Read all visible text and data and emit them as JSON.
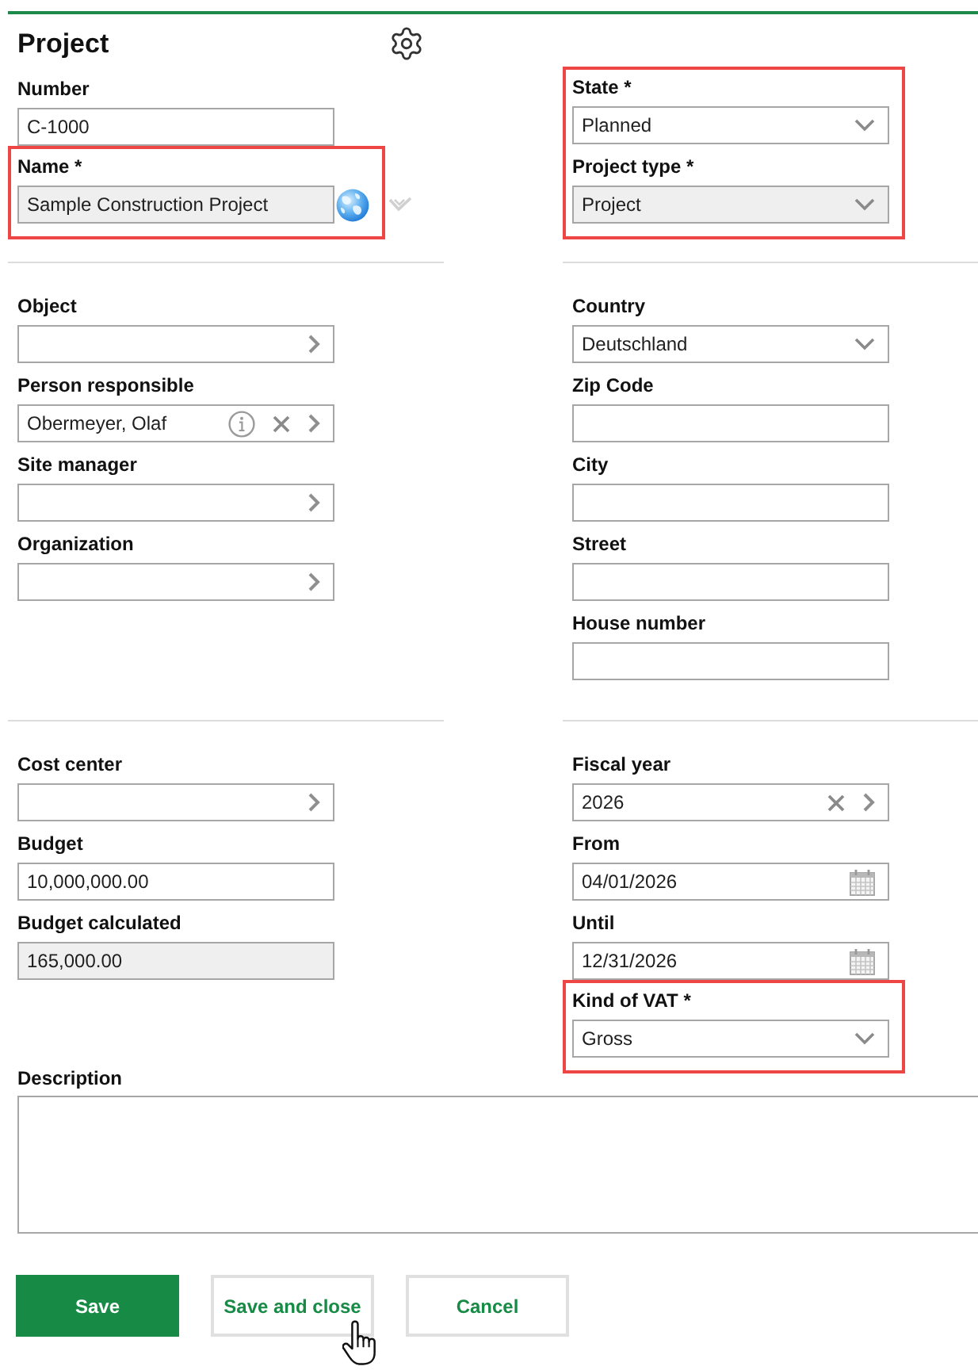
{
  "title": "Project",
  "sections": [
    {
      "left": [
        {
          "label": "Number",
          "value": "C-1000",
          "readonly": false,
          "highlighted": false
        },
        {
          "label": "Name *",
          "value": "Sample Construction Project",
          "readonly": true,
          "highlighted": true,
          "side_icons": [
            {
              "kind": "globe"
            }
          ],
          "trailing_icons": [
            {
              "kind": "expand"
            }
          ]
        }
      ],
      "right": [
        {
          "label": "State *",
          "value": "Planned",
          "readonly": false,
          "highlighted": true,
          "icons": [
            {
              "kind": "dropdown"
            }
          ]
        },
        {
          "label": "Project type *",
          "value": "Project",
          "readonly": true,
          "highlighted": true,
          "icons": [
            {
              "kind": "dropdown"
            }
          ]
        }
      ]
    },
    {
      "left": [
        {
          "label": "Object",
          "readonly": false,
          "highlighted": false,
          "icons": [
            {
              "kind": "next"
            }
          ]
        },
        {
          "label": "Person responsible",
          "value": "Obermeyer, Olaf",
          "readonly": false,
          "highlighted": false,
          "icons": [
            {
              "kind": "info"
            },
            {
              "kind": "clear"
            },
            {
              "kind": "next"
            }
          ]
        },
        {
          "label": "Site manager",
          "readonly": false,
          "highlighted": false,
          "icons": [
            {
              "kind": "next"
            }
          ]
        },
        {
          "label": "Organization",
          "readonly": false,
          "highlighted": false,
          "icons": [
            {
              "kind": "next"
            }
          ]
        }
      ],
      "right": [
        {
          "label": "Country",
          "value": "Deutschland",
          "readonly": false,
          "highlighted": false,
          "icons": [
            {
              "kind": "dropdown"
            }
          ]
        },
        {
          "label": "Zip Code",
          "readonly": false,
          "highlighted": false
        },
        {
          "label": "City",
          "readonly": false,
          "highlighted": false
        },
        {
          "label": "Street",
          "readonly": false,
          "highlighted": false
        },
        {
          "label": "House number",
          "readonly": false,
          "highlighted": false
        }
      ]
    },
    {
      "left": [
        {
          "label": "Cost center",
          "readonly": false,
          "highlighted": false,
          "icons": [
            {
              "kind": "next"
            }
          ]
        },
        {
          "label": "Budget",
          "value": "10,000,000.00",
          "readonly": false,
          "highlighted": false
        },
        {
          "label": "Budget calculated",
          "value": "165,000.00",
          "readonly": true,
          "highlighted": false
        }
      ],
      "right": [
        {
          "label": "Fiscal year",
          "value": "2026",
          "readonly": false,
          "highlighted": false,
          "icons": [
            {
              "kind": "clear"
            },
            {
              "kind": "next"
            }
          ]
        },
        {
          "label": "From",
          "value": "04/01/2026",
          "readonly": false,
          "highlighted": false,
          "icons": [
            {
              "kind": "calendar"
            }
          ]
        },
        {
          "label": "Until",
          "value": "12/31/2026",
          "readonly": false,
          "highlighted": false,
          "icons": [
            {
              "kind": "calendar"
            }
          ]
        },
        {
          "label": "Kind of VAT *",
          "value": "Gross",
          "readonly": false,
          "highlighted": true,
          "icons": [
            {
              "kind": "dropdown"
            }
          ]
        }
      ]
    }
  ],
  "description": {
    "label": "Description"
  },
  "buttons": [
    {
      "label": "Save",
      "kind": "primary"
    },
    {
      "label": "Save and close",
      "kind": "secondary"
    },
    {
      "label": "Cancel",
      "kind": "secondary"
    }
  ]
}
